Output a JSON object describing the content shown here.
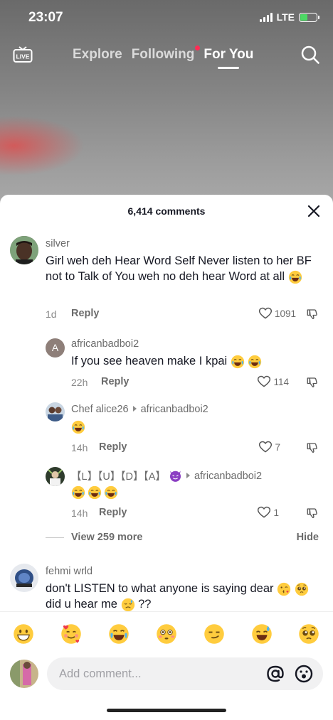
{
  "status": {
    "time": "23:07",
    "network": "LTE"
  },
  "topnav": {
    "live_label": "LIVE",
    "tabs": [
      {
        "label": "Explore"
      },
      {
        "label": "Following"
      },
      {
        "label": "For You"
      }
    ]
  },
  "comments_header": {
    "count": "6,414 comments"
  },
  "comments": [
    {
      "user": "silver",
      "text": "Girl weh deh Hear Word Self Never listen to her BF not to Talk of You weh no deh hear Word at all",
      "emojis": [
        "joy"
      ],
      "age": "1d",
      "reply": "Reply",
      "likes": "1091"
    },
    {
      "avatar_letter": "A",
      "user": "africanbadboi2",
      "text": "If you see heaven make I kpai",
      "emojis": [
        "joy",
        "joy"
      ],
      "age": "22h",
      "reply": "Reply",
      "likes": "114"
    },
    {
      "user": "Chef alice26",
      "reply_to": "africanbadboi2",
      "text": "",
      "emojis": [
        "joy"
      ],
      "age": "14h",
      "reply": "Reply",
      "likes": "7"
    },
    {
      "user": "【L】【U】【D】【A】",
      "reply_to": "africanbadboi2",
      "text": "",
      "emojis": [
        "joy",
        "joy",
        "joy"
      ],
      "age": "14h",
      "reply": "Reply",
      "likes": "1"
    },
    {
      "user": "fehmi wrld",
      "text_1": "don't LISTEN to what anyone is saying dear",
      "text_2": "did u hear me",
      "text_3": "??"
    }
  ],
  "view_more": "View 259 more",
  "hide": "Hide",
  "emoji_bar": [
    "grin",
    "smiling-hearts",
    "joy",
    "flushed",
    "smirk",
    "sweat-smile",
    "pleading"
  ],
  "input": {
    "placeholder": "Add comment..."
  },
  "colors": {
    "accent_red": "#fe2c55",
    "text_primary": "#161823",
    "text_secondary": "#6b6b6b"
  }
}
